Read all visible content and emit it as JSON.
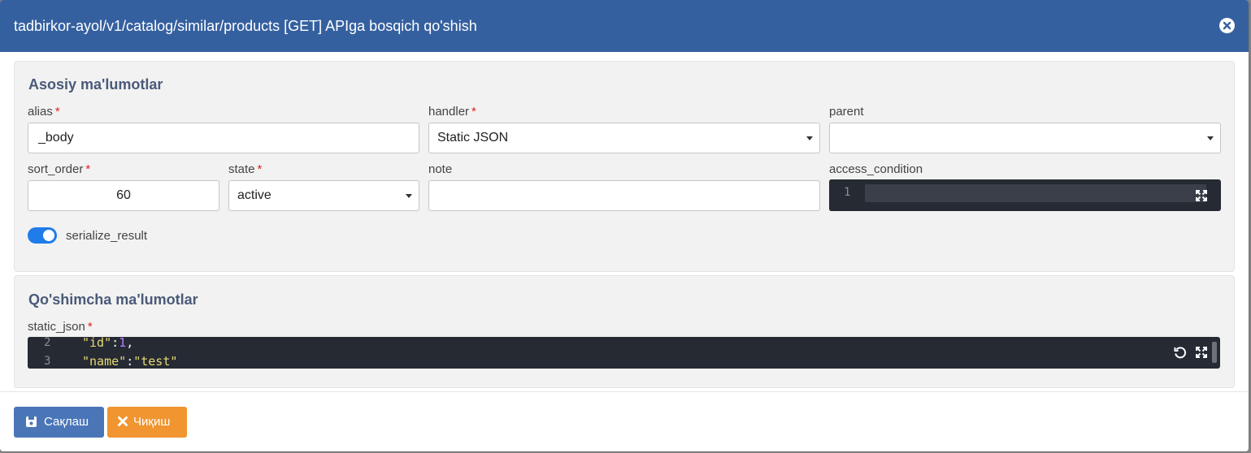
{
  "dialog": {
    "title": "tadbirkor-ayol/v1/catalog/similar/products [GET] APIga bosqich qo'shish",
    "close_icon": "close-circle-icon"
  },
  "main_section": {
    "title": "Asosiy ma'lumotlar",
    "alias": {
      "label": "alias",
      "value": "_body",
      "required": "*"
    },
    "handler": {
      "label": "handler",
      "value": "Static JSON",
      "required": "*"
    },
    "parent": {
      "label": "parent",
      "value": ""
    },
    "sort_order": {
      "label": "sort_order",
      "value": "60",
      "required": "*"
    },
    "state": {
      "label": "state",
      "value": "active",
      "required": "*"
    },
    "note": {
      "label": "note",
      "value": ""
    },
    "access_condition": {
      "label": "access_condition",
      "line_number": "1"
    },
    "serialize_result": {
      "label": "serialize_result",
      "checked": true
    }
  },
  "extra_section": {
    "title": "Qo'shimcha ma'lumotlar",
    "static_json": {
      "label": "static_json",
      "required": "*",
      "lines": [
        {
          "number": "2",
          "key": "\"id\"",
          "sep": ":",
          "value": "1",
          "tail": ","
        },
        {
          "number": "3",
          "key": "\"name\"",
          "sep": ":",
          "value": "\"test\"",
          "tail": ""
        }
      ]
    }
  },
  "footer": {
    "save_label": "Сақлаш",
    "exit_label": "Чиқиш",
    "save_icon": "floppy-disk-icon",
    "exit_icon": "x-icon"
  },
  "colors": {
    "header": "#3560a0",
    "save_button": "#4a76b8",
    "exit_button": "#f0952f",
    "toggle_on": "#1f7ce8",
    "editor_bg": "#262a33",
    "required": "#e02020"
  }
}
